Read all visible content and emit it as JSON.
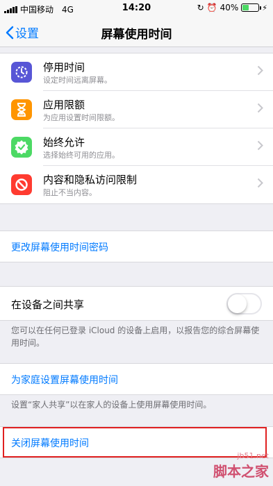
{
  "status_bar": {
    "carrier": "中国移动",
    "network": "4G",
    "time": "14:20",
    "battery_percent": "40%",
    "battery_level": 0.4
  },
  "nav": {
    "back_label": "设置",
    "title": "屏幕使用时间"
  },
  "features": [
    {
      "title": "停用时间",
      "subtitle": "设定时间远离屏幕。",
      "icon": "downtime-icon",
      "color": "#5856d6"
    },
    {
      "title": "应用限额",
      "subtitle": "为应用设置时间限额。",
      "icon": "hourglass-icon",
      "color": "#ff9500"
    },
    {
      "title": "始终允许",
      "subtitle": "选择始终可用的应用。",
      "icon": "checkmark-badge-icon",
      "color": "#4cd964"
    },
    {
      "title": "内容和隐私访问限制",
      "subtitle": "阻止不当内容。",
      "icon": "prohibited-icon",
      "color": "#ff3b30"
    }
  ],
  "passcode_link": "更改屏幕使用时间密码",
  "share": {
    "label": "在设备之间共享",
    "enabled": false,
    "footer": "您可以在任何已登录 iCloud 的设备上启用，以报告您的综合屏幕使用时间。"
  },
  "family_link": "为家庭设置屏幕使用时间",
  "family_footer": "设置“家人共享”以在家人的设备上使用屏幕使用时间。",
  "turn_off_link": "关闭屏幕使用时间",
  "watermark": {
    "url": "jb51.net",
    "name": "脚本之家"
  }
}
